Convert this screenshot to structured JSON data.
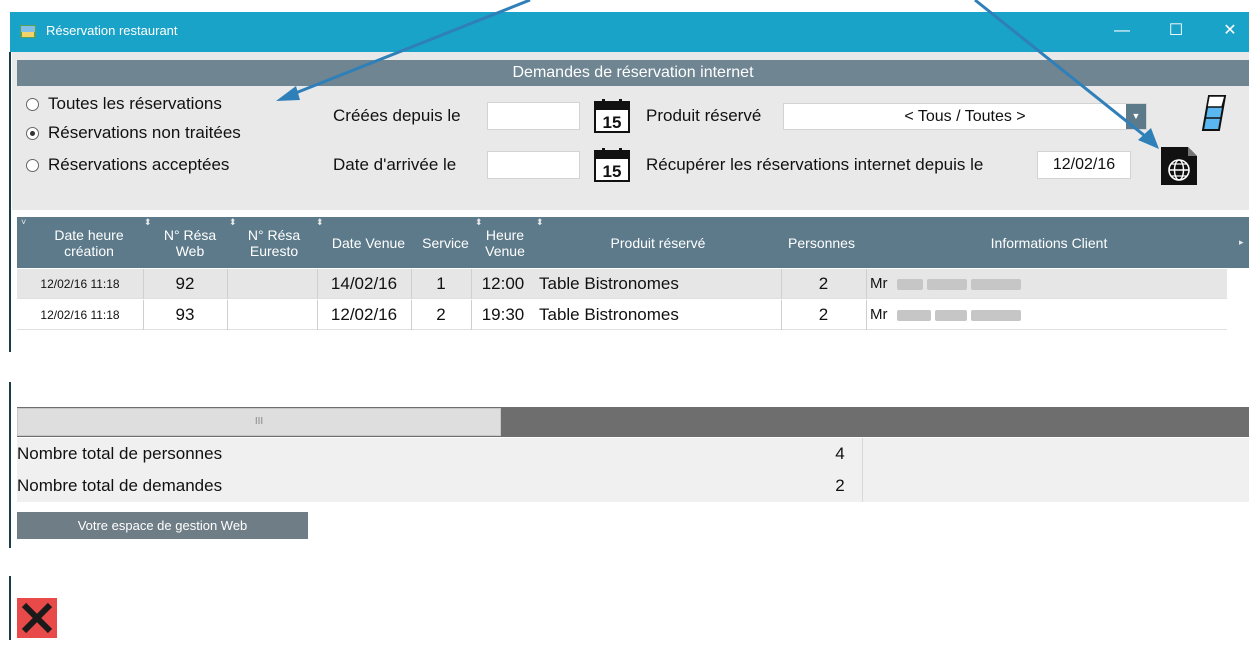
{
  "window": {
    "title": "Réservation restaurant",
    "minimize": "—",
    "maximize": "☐",
    "close": "✕"
  },
  "header": {
    "section_title": "Demandes de réservation internet"
  },
  "filters": {
    "radios": [
      {
        "label": "Toutes les réservations",
        "checked": false
      },
      {
        "label": "Réservations non traitées",
        "checked": true
      },
      {
        "label": "Réservations acceptées",
        "checked": false
      }
    ],
    "created_since_label": "Créées depuis le",
    "created_since_value": "",
    "arrival_date_label": "Date d'arrivée le",
    "arrival_date_value": "",
    "calendar_day": "15",
    "product_label": "Produit réservé",
    "product_value": "< Tous / Toutes >",
    "fetch_label": "Récupérer les réservations internet depuis le",
    "fetch_date": "12/02/16"
  },
  "grid": {
    "columns": [
      "Date heure création",
      "N° Résa Web",
      "N° Résa Euresto",
      "Date Venue",
      "Service",
      "Heure Venue",
      "Produit réservé",
      "Personnes",
      "Informations Client"
    ],
    "rows": [
      {
        "created": "12/02/16 11:18",
        "web_no": "92",
        "euresto_no": "",
        "date": "14/02/16",
        "service": "1",
        "time": "12:00",
        "product": "Table Bistronomes",
        "persons": "2",
        "client": "Mr"
      },
      {
        "created": "12/02/16 11:18",
        "web_no": "93",
        "euresto_no": "",
        "date": "12/02/16",
        "service": "2",
        "time": "19:30",
        "product": "Table Bistronomes",
        "persons": "2",
        "client": "Mr"
      }
    ],
    "scroll_grip": "III"
  },
  "totals": {
    "persons_label": "Nombre total de personnes",
    "persons_value": "4",
    "requests_label": "Nombre total de demandes",
    "requests_value": "2"
  },
  "footer": {
    "web_button": "Votre espace de gestion Web"
  },
  "icons": {
    "app": "restaurant-app-icon",
    "calendar": "calendar-icon",
    "eraser": "eraser-icon",
    "globe": "globe-icon",
    "close_x": "red-close-icon"
  },
  "colors": {
    "titlebar": "#1aa3c8",
    "section_header": "#6f8592",
    "grid_header": "#5d7a8a",
    "arrow": "#2f7fb8",
    "close_x": "#e84a4a"
  }
}
